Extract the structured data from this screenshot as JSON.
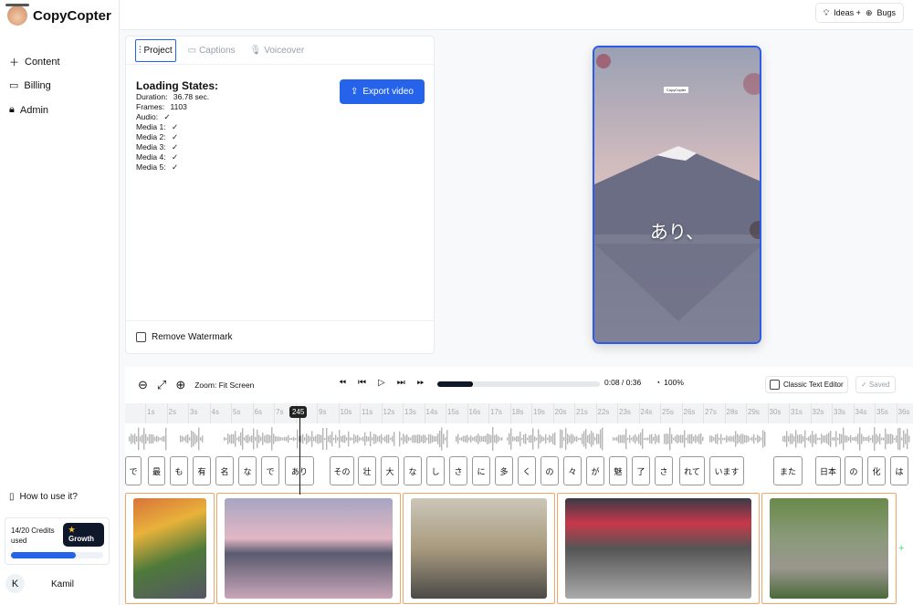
{
  "app": {
    "name": "CopyCopter"
  },
  "sidebar": {
    "items": [
      {
        "label": "Content",
        "icon": "plus-icon"
      },
      {
        "label": "Billing",
        "icon": "credit-card-icon"
      },
      {
        "label": "Admin",
        "icon": "lock-icon"
      }
    ],
    "help": "How to use it?",
    "credits": {
      "text": "14/20 Credits used",
      "used": 14,
      "total": 20,
      "plan": "Growth"
    },
    "user": {
      "initial": "K",
      "name": "Kamil"
    }
  },
  "topbar": {
    "ideas": "Ideas +",
    "bugs": "Bugs"
  },
  "panel": {
    "tabs": [
      {
        "label": "Project",
        "active": true
      },
      {
        "label": "Captions"
      },
      {
        "label": "Voiceover"
      }
    ],
    "loading_title": "Loading States:",
    "rows": [
      {
        "label": "Duration:",
        "value": "36.78 sec."
      },
      {
        "label": "Frames:",
        "value": "1103"
      },
      {
        "label": "Audio:",
        "value": "✓"
      },
      {
        "label": "Media 1:",
        "value": "✓"
      },
      {
        "label": "Media 2:",
        "value": "✓"
      },
      {
        "label": "Media 3:",
        "value": "✓"
      },
      {
        "label": "Media 4:",
        "value": "✓"
      },
      {
        "label": "Media 5:",
        "value": "✓"
      }
    ],
    "export": "Export video",
    "watermark": "Remove Watermark"
  },
  "preview": {
    "caption": "あり、",
    "watermark": "CopyCopter"
  },
  "timeline": {
    "zoom": "Zoom: Fit Screen",
    "time": "0:08 / 0:36",
    "progress": 0.22,
    "speed": "100%",
    "classic": "Classic Text Editor",
    "saved": "✓ Saved",
    "playhead": "245",
    "ticks": [
      "1s",
      "2s",
      "3s",
      "4s",
      "5s",
      "6s",
      "7s",
      "8s",
      "9s",
      "10s",
      "11s",
      "12s",
      "13s",
      "14s",
      "15s",
      "16s",
      "17s",
      "18s",
      "19s",
      "20s",
      "21s",
      "22s",
      "23s",
      "24s",
      "25s",
      "26s",
      "27s",
      "28s",
      "29s",
      "30s",
      "31s",
      "32s",
      "33s",
      "34s",
      "35s",
      "36s"
    ],
    "words": [
      "で",
      "最",
      "も",
      "有",
      "名",
      "な",
      "で",
      "あり",
      "その",
      "壮",
      "大",
      "な",
      "し",
      "さ",
      "に",
      "多",
      "く",
      "の",
      "々",
      "が",
      "魅",
      "了",
      "さ",
      "れて",
      "います",
      "また",
      "日本",
      "の",
      "化",
      "は"
    ],
    "media": [
      "Japanese garden in autumn",
      "Mount Fuji with cherry blossoms",
      "Woman in kimono tea ceremony",
      "Shibuya crossing",
      "Zen stone garden"
    ]
  },
  "colors": {
    "accent": "#2563eb",
    "clip_border": "#f2a56b"
  }
}
